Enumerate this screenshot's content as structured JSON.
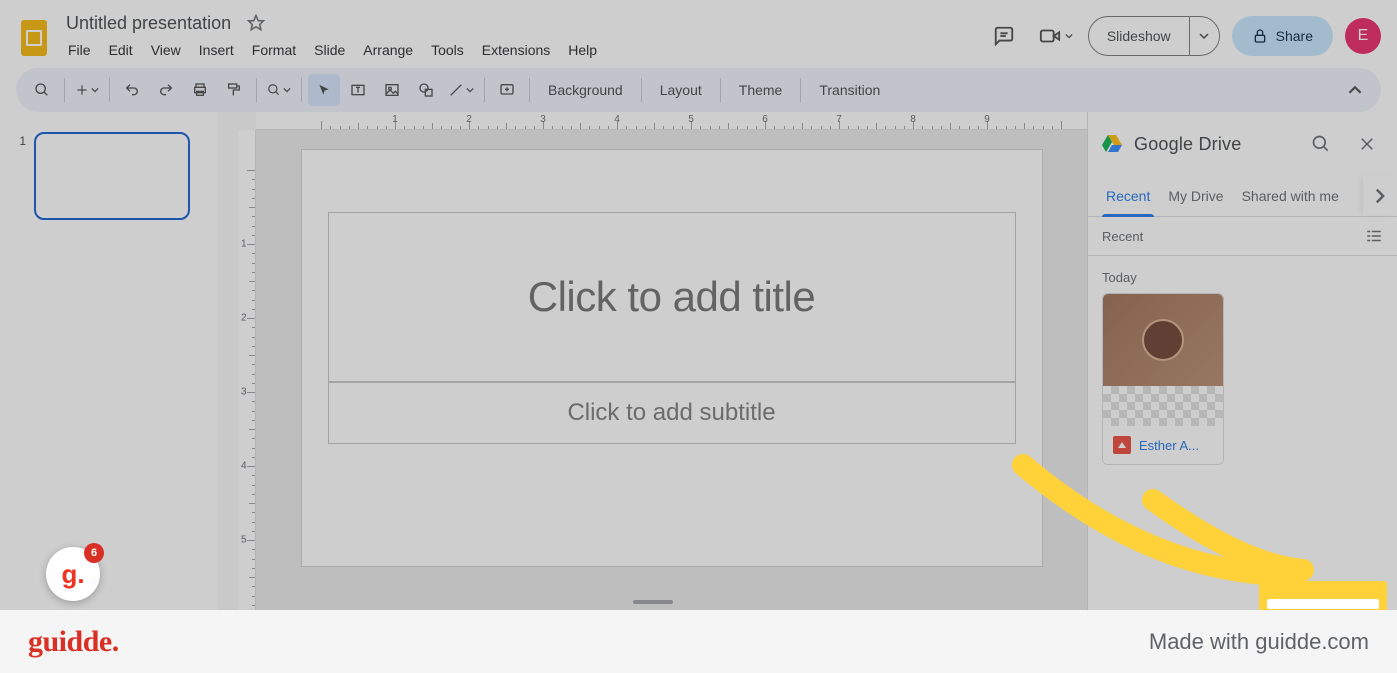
{
  "header": {
    "doc_title": "Untitled presentation",
    "menus": [
      "File",
      "Edit",
      "View",
      "Insert",
      "Format",
      "Slide",
      "Arrange",
      "Tools",
      "Extensions",
      "Help"
    ],
    "slideshow_label": "Slideshow",
    "share_label": "Share",
    "avatar_letter": "E"
  },
  "toolbar": {
    "background": "Background",
    "layout": "Layout",
    "theme": "Theme",
    "transition": "Transition"
  },
  "filmstrip": {
    "slide_number": "1"
  },
  "canvas": {
    "title_placeholder": "Click to add title",
    "subtitle_placeholder": "Click to add subtitle"
  },
  "side_panel": {
    "title": "Google Drive",
    "tabs": {
      "recent": "Recent",
      "mydrive": "My Drive",
      "shared": "Shared with me"
    },
    "section_label": "Recent",
    "group_label": "Today",
    "file_name": "Esther A..."
  },
  "guidde_badge": {
    "count": "6"
  },
  "footer": {
    "logo": "guidde.",
    "credit": "Made with guidde.com"
  },
  "ruler": {
    "h_labels": [
      "1",
      "2",
      "3",
      "4",
      "5",
      "6",
      "7",
      "8",
      "9"
    ],
    "v_labels": [
      "1",
      "2",
      "3",
      "4",
      "5"
    ]
  }
}
